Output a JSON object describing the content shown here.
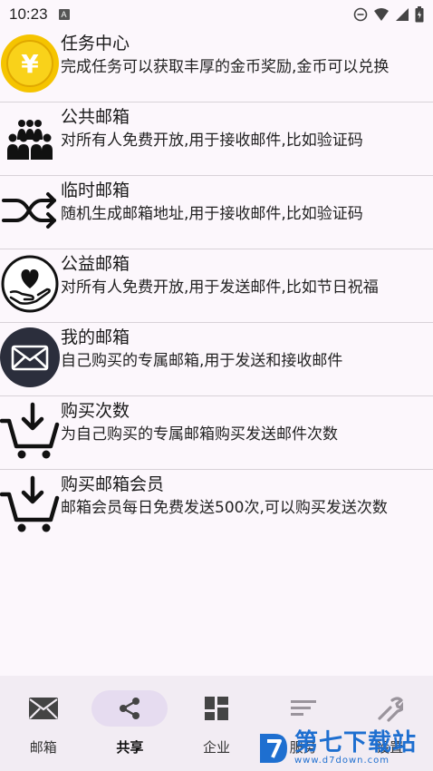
{
  "status_bar": {
    "time": "10:23",
    "badge": "A"
  },
  "list": [
    {
      "title": "任务中心",
      "desc": "完成任务可以获取丰厚的金币奖励,金币可以兑换",
      "icon": "gold-coin-icon"
    },
    {
      "title": "公共邮箱",
      "desc": "对所有人免费开放,用于接收邮件,比如验证码",
      "icon": "group-people-icon"
    },
    {
      "title": "临时邮箱",
      "desc": "随机生成邮箱地址,用于接收邮件,比如验证码",
      "icon": "shuffle-icon"
    },
    {
      "title": "公益邮箱",
      "desc": "对所有人免费开放,用于发送邮件,比如节日祝福",
      "icon": "heart-hand-icon"
    },
    {
      "title": "我的邮箱",
      "desc": "自己购买的专属邮箱,用于发送和接收邮件",
      "icon": "envelope-circle-icon"
    },
    {
      "title": "购买次数",
      "desc": "为自己购买的专属邮箱购买发送邮件次数",
      "icon": "cart-download-icon"
    },
    {
      "title": "购买邮箱会员",
      "desc": "邮箱会员每日免费发送500次,可以购买发送次数",
      "icon": "cart-download-icon"
    }
  ],
  "bottom_nav": [
    {
      "label": "邮箱",
      "icon": "mail-icon",
      "active": false
    },
    {
      "label": "共享",
      "icon": "share-icon",
      "active": true
    },
    {
      "label": "企业",
      "icon": "dashboard-icon",
      "active": false
    },
    {
      "label": "服务",
      "icon": "notes-icon",
      "active": false
    },
    {
      "label": "设置",
      "icon": "wrench-icon",
      "active": false
    }
  ],
  "watermark": {
    "big": "第七下载站",
    "small": "www.d7down.com"
  },
  "colors": {
    "accent_pill": "#e6dcf0",
    "nav_bg": "#f2ecf3",
    "background": "#fcf7fc",
    "coin": "#f5c400",
    "watermark": "#1e6fd0"
  }
}
